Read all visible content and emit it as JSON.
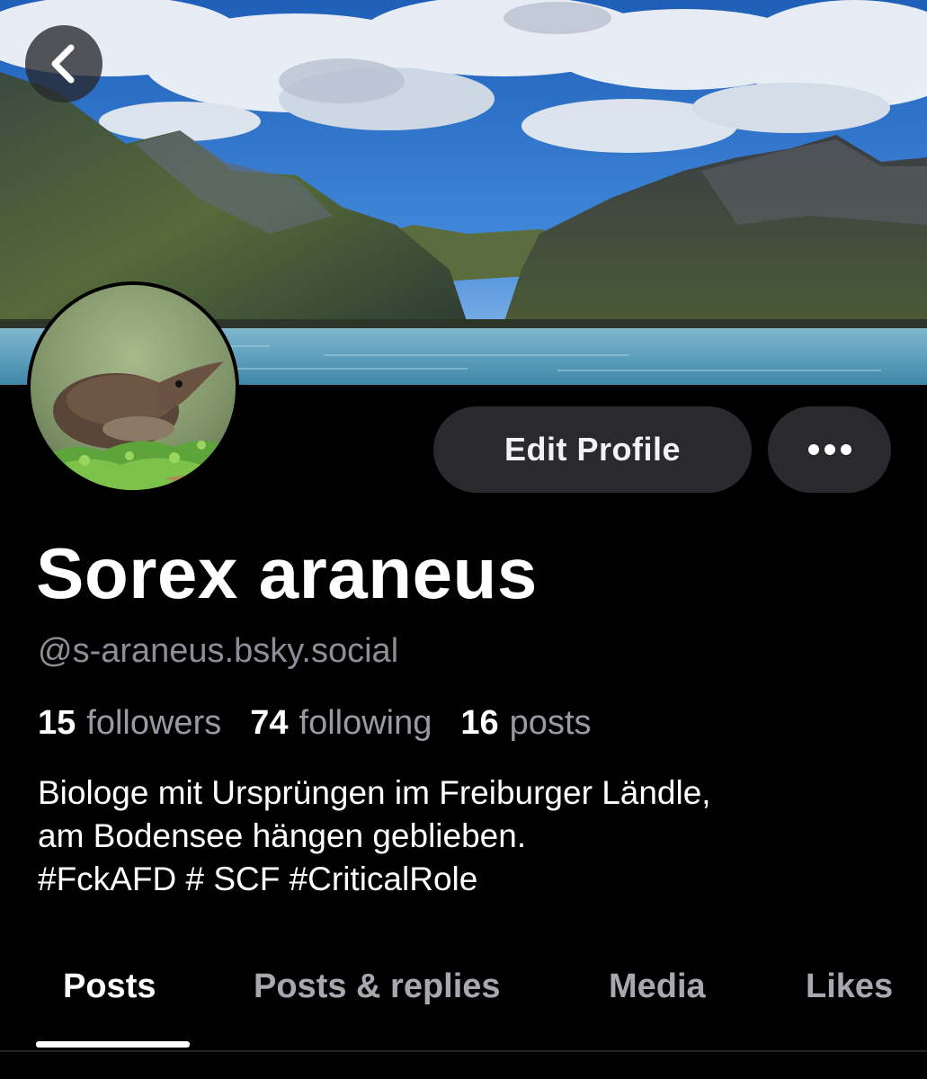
{
  "header": {
    "back_icon": "chevron-left-icon",
    "banner_alt": "mountain lake banner"
  },
  "profile": {
    "display_name": "Sorex araneus",
    "handle": "@s-araneus.bsky.social",
    "avatar_alt": "shrew avatar"
  },
  "actions": {
    "edit_profile_label": "Edit Profile",
    "more_icon": "ellipsis-icon"
  },
  "stats": [
    {
      "count": "15",
      "label": "followers"
    },
    {
      "count": "74",
      "label": "following"
    },
    {
      "count": "16",
      "label": "posts"
    }
  ],
  "bio": {
    "lines": [
      "Biologe mit Ursprüngen im Freiburger Ländle,",
      "am Bodensee hängen geblieben.",
      "#FckAFD # SCF #CriticalRole"
    ]
  },
  "tabs": [
    {
      "label": "Posts",
      "active": true
    },
    {
      "label": "Posts & replies",
      "active": false
    },
    {
      "label": "Media",
      "active": false
    },
    {
      "label": "Likes",
      "active": false
    }
  ],
  "colors": {
    "background": "#000000",
    "button_bg": "#2a2a2e",
    "muted_text": "#8e8e96",
    "tab_inactive": "#a8a8b0"
  }
}
